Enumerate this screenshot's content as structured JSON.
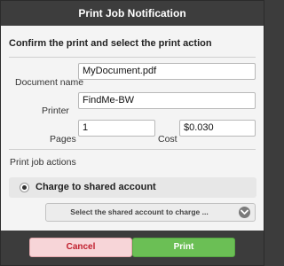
{
  "dialog": {
    "title": "Print Job Notification",
    "subtitle": "Confirm the print and select the print action"
  },
  "fields": {
    "document_name": {
      "label": "Document name",
      "value": "MyDocument.pdf"
    },
    "printer": {
      "label": "Printer",
      "value": "FindMe-BW"
    },
    "pages": {
      "label": "Pages",
      "value": "1"
    },
    "cost": {
      "label": "Cost",
      "value": "$0.030"
    }
  },
  "actions": {
    "section_label": "Print job actions",
    "radio_option": {
      "label": "Charge to shared account",
      "selected": true
    },
    "shared_account_select": {
      "value": "Select the shared account to charge ..."
    }
  },
  "buttons": {
    "cancel": "Cancel",
    "print": "Print"
  },
  "colors": {
    "titlebar": "#3d3d3d",
    "cancel_bg": "#f7d5d8",
    "cancel_text": "#c0202e",
    "print_bg": "#6bbf55"
  },
  "icons": {
    "radio": "radio-selected-icon",
    "dropdown": "chevron-down-icon"
  }
}
